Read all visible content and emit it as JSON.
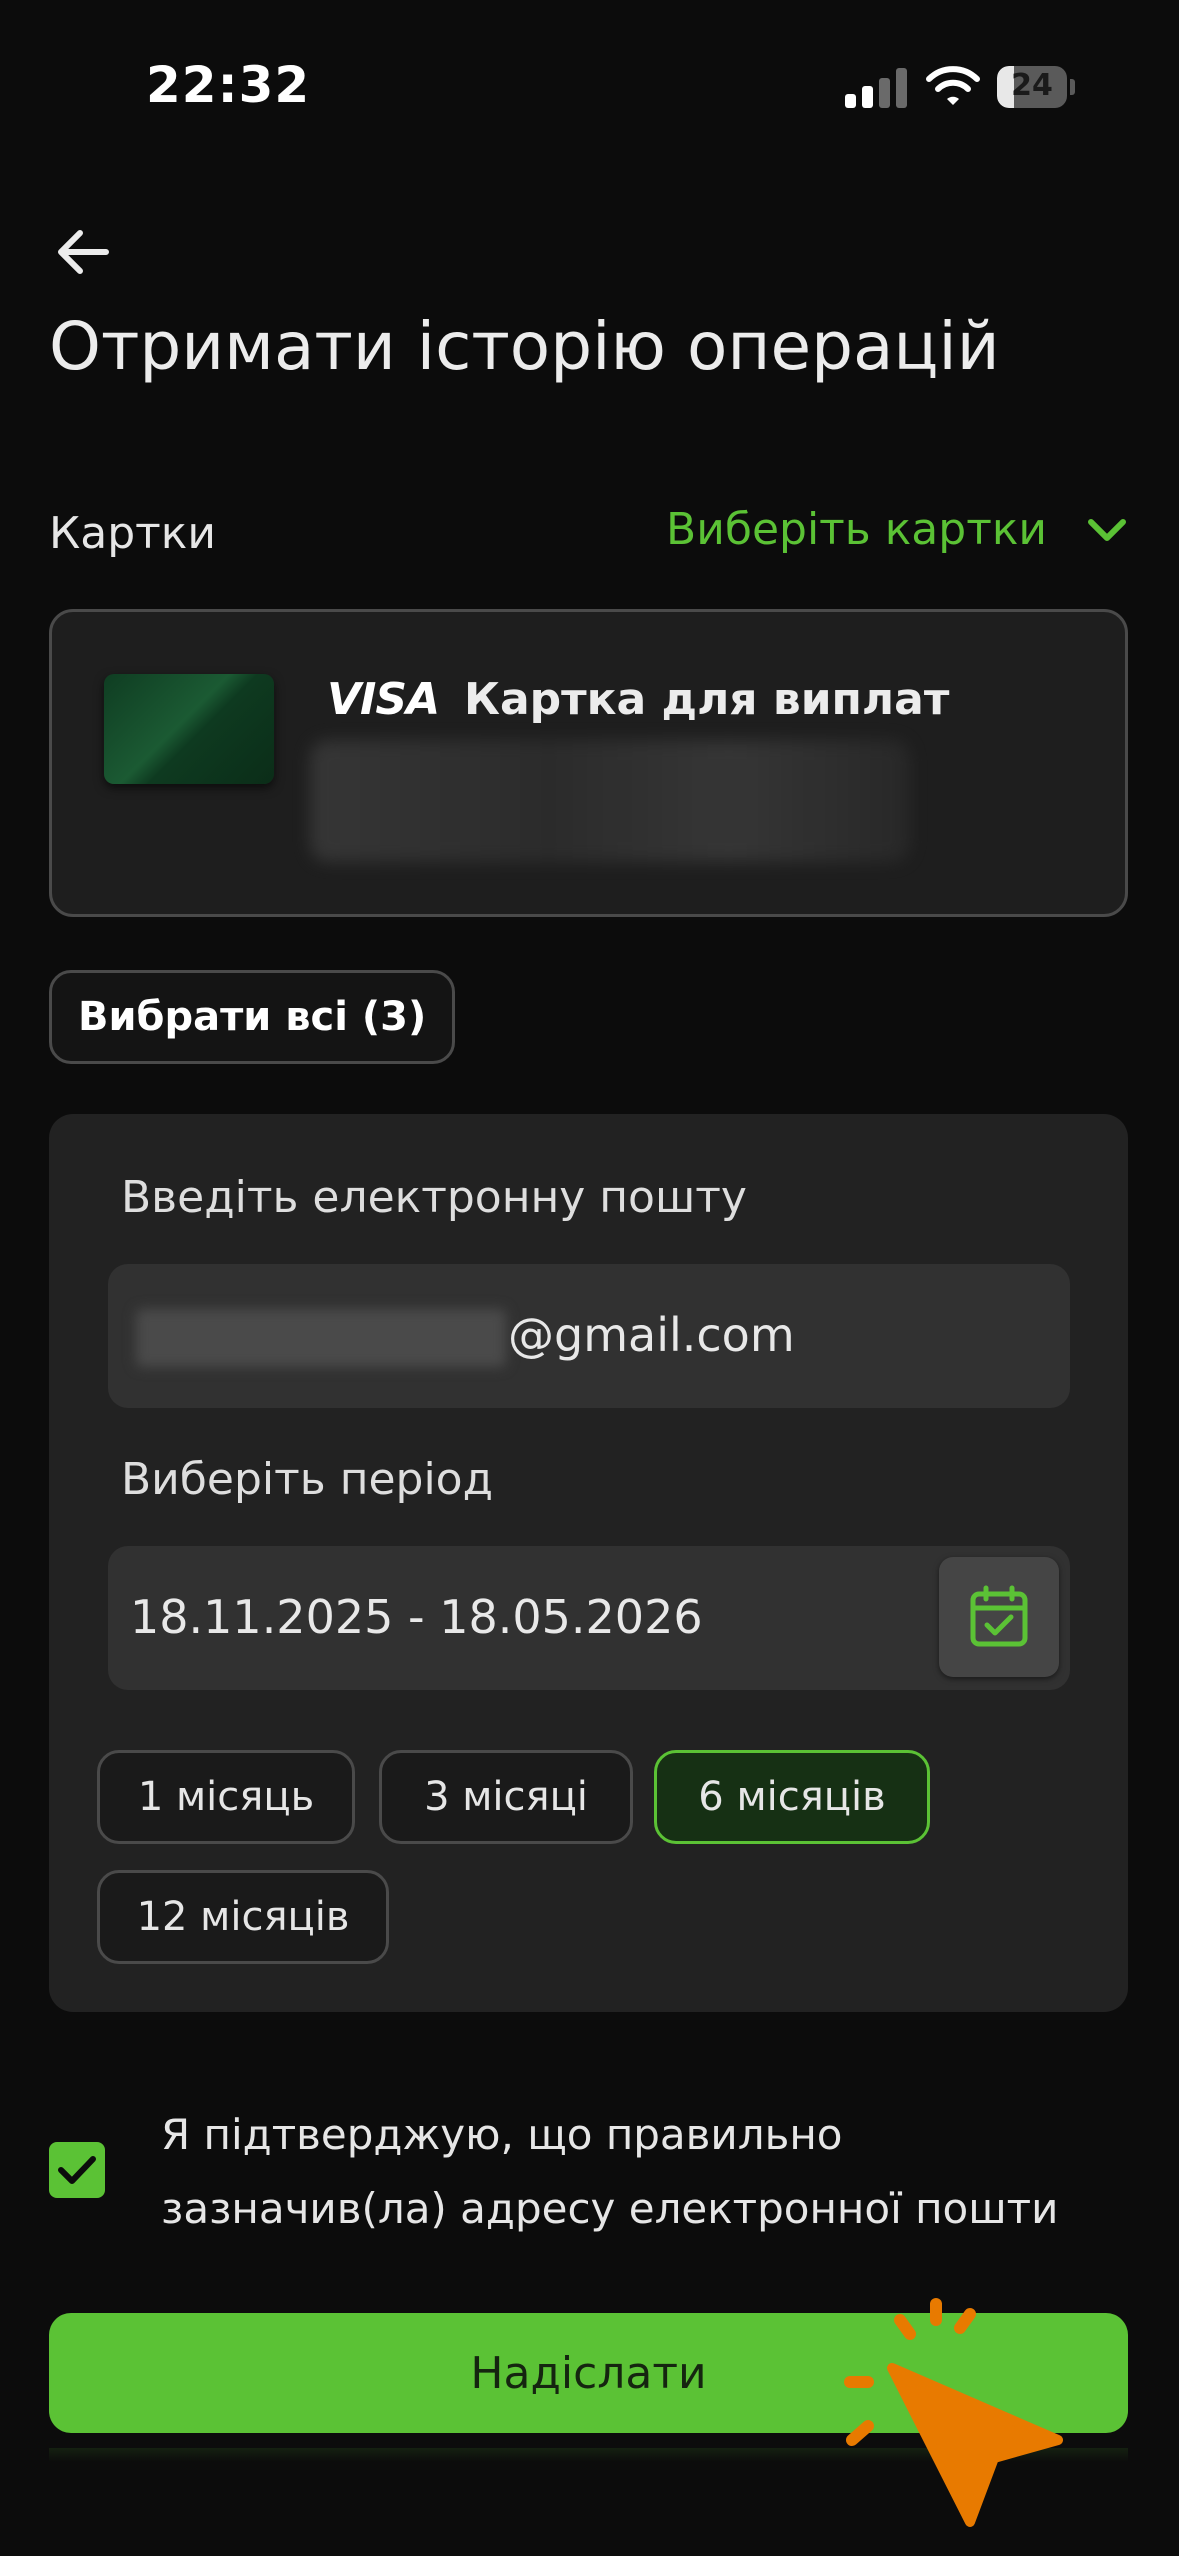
{
  "status_bar": {
    "time": "22:32",
    "battery": "24",
    "battery_level": 0.24
  },
  "header": {
    "title": "Отримати історію операцій"
  },
  "cards": {
    "label": "Картки",
    "choose_label": "Виберіть картки",
    "card": {
      "brand": "VISA",
      "name": "Картка для виплат"
    },
    "select_all_label": "Вибрати всі (3)"
  },
  "form": {
    "email_label": "Введіть електронну пошту",
    "email_value_visible": "@gmail.com",
    "period_label": "Виберіть період",
    "period_value": "18.11.2025 - 18.05.2026",
    "period_options": [
      {
        "label": "1 місяць",
        "selected": false
      },
      {
        "label": "3 місяці",
        "selected": false
      },
      {
        "label": "6 місяців",
        "selected": true
      },
      {
        "label": "12 місяців",
        "selected": false
      }
    ]
  },
  "confirm": {
    "checked": true,
    "text": "Я підтверджую, що правильно зазначив(ла) адресу електронної пошти"
  },
  "submit_label": "Надіслати",
  "colors": {
    "accent": "#5bc235",
    "background": "#0c0c0c",
    "panel": "#222222",
    "tap_indicator": "#e87a00"
  },
  "icons": [
    "back-arrow-icon",
    "chevron-down-icon",
    "calendar-check-icon",
    "checkmark-icon",
    "cellular-signal-icon",
    "wifi-icon",
    "battery-icon",
    "tap-cursor-icon"
  ]
}
